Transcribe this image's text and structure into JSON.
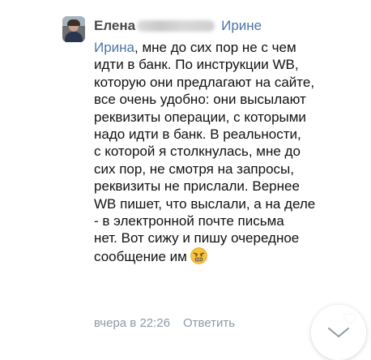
{
  "comment": {
    "author": "Елена",
    "recipient": "Ирине",
    "mention": "Ирина",
    "lines": [
      ", мне до сих пор не с чем",
      "идти в банк. По инструкции WB,",
      "которую они предлагают на сайте,",
      "все очень удобно: они высылают",
      "реквизиты операции, с которыми",
      "надо идти в банк. В реальности,",
      "с которой я столкнулась, мне до",
      "сих пор, не смотря на запросы,",
      "реквизиты не прислали. Вернее",
      "WB пишет, что выслали, а на деле",
      "- в электронной почте письма",
      "нет. Вот сижу и пишу очередное",
      "сообщение им"
    ],
    "emoji": "angry-face-emoji",
    "timestamp": "вчера в 22:26",
    "reply_label": "Ответить"
  },
  "icons": {
    "avatar": "user-avatar",
    "like": "heart-icon",
    "scroll": "chevron-down-icon"
  },
  "colors": {
    "link": "#4b76a8",
    "meta": "#8e99a4",
    "text": "#111111"
  }
}
